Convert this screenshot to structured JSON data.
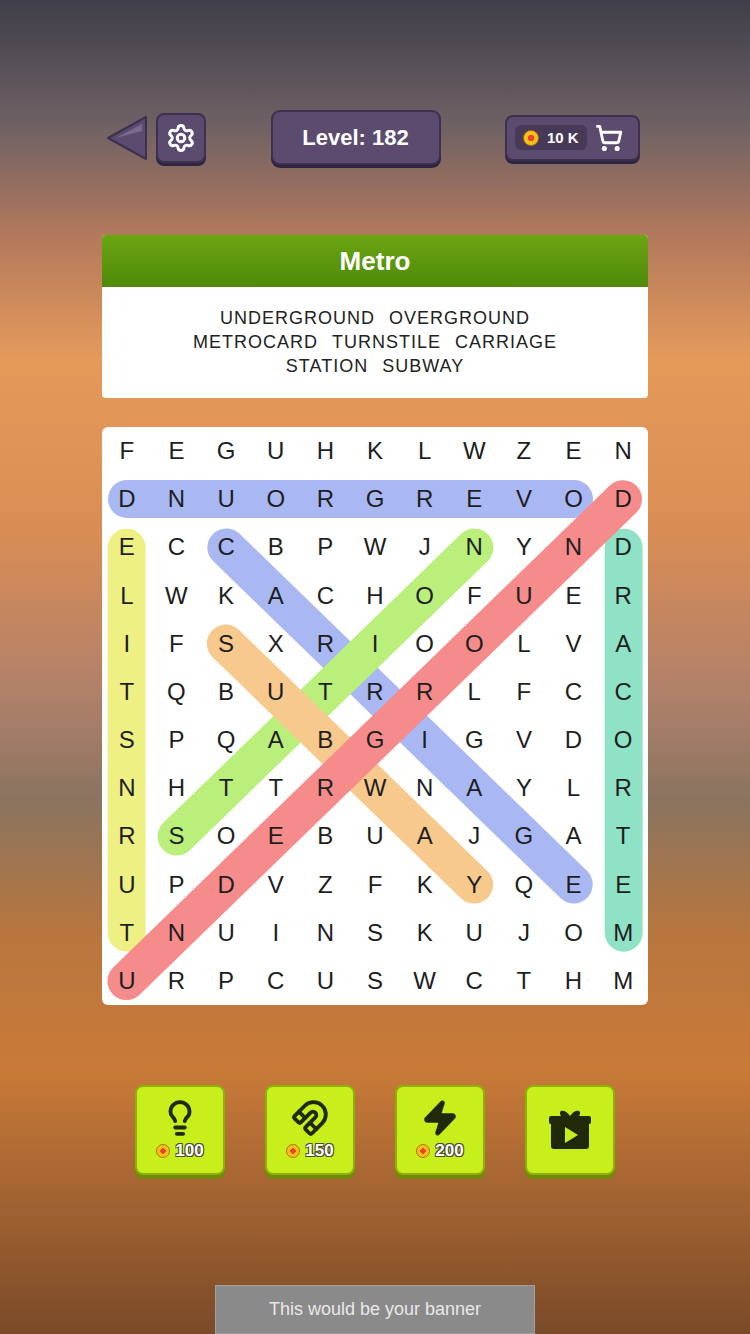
{
  "top_bar": {
    "level_label": "Level: 182",
    "coins": "10 K"
  },
  "puzzle": {
    "title": "Metro",
    "word_rows": [
      [
        "UNDERGROUND",
        "OVERGROUND"
      ],
      [
        "METROCARD",
        "TURNSTILE",
        "CARRIAGE"
      ],
      [
        "STATION",
        "SUBWAY"
      ]
    ]
  },
  "grid": {
    "rows": [
      [
        "F",
        "E",
        "G",
        "U",
        "H",
        "K",
        "L",
        "W",
        "Z",
        "E",
        "N"
      ],
      [
        "D",
        "N",
        "U",
        "O",
        "R",
        "G",
        "R",
        "E",
        "V",
        "O",
        "D"
      ],
      [
        "E",
        "C",
        "C",
        "B",
        "P",
        "W",
        "J",
        "N",
        "Y",
        "N",
        "D"
      ],
      [
        "L",
        "W",
        "K",
        "A",
        "C",
        "H",
        "O",
        "F",
        "U",
        "E",
        "R"
      ],
      [
        "I",
        "F",
        "S",
        "X",
        "R",
        "I",
        "O",
        "O",
        "L",
        "V",
        "A"
      ],
      [
        "T",
        "Q",
        "B",
        "U",
        "T",
        "R",
        "R",
        "L",
        "F",
        "C",
        "C"
      ],
      [
        "S",
        "P",
        "Q",
        "A",
        "B",
        "G",
        "I",
        "G",
        "V",
        "D",
        "O"
      ],
      [
        "N",
        "H",
        "T",
        "T",
        "R",
        "W",
        "N",
        "A",
        "Y",
        "L",
        "R"
      ],
      [
        "R",
        "S",
        "O",
        "E",
        "B",
        "U",
        "A",
        "J",
        "G",
        "A",
        "T"
      ],
      [
        "U",
        "P",
        "D",
        "V",
        "Z",
        "F",
        "K",
        "Y",
        "Q",
        "E",
        "E"
      ],
      [
        "T",
        "N",
        "U",
        "I",
        "N",
        "S",
        "K",
        "U",
        "J",
        "O",
        "M"
      ],
      [
        "U",
        "R",
        "P",
        "C",
        "U",
        "S",
        "W",
        "C",
        "T",
        "H",
        "M"
      ]
    ],
    "found_lines": [
      {
        "from": [
          1,
          0
        ],
        "to": [
          1,
          9
        ],
        "color": "#a9b7f3"
      },
      {
        "from": [
          10,
          0
        ],
        "to": [
          2,
          0
        ],
        "color": "#eef083"
      },
      {
        "from": [
          10,
          10
        ],
        "to": [
          2,
          10
        ],
        "color": "#8fe2c6"
      },
      {
        "from": [
          2,
          2
        ],
        "to": [
          9,
          9
        ],
        "color": "#a9b7f3"
      },
      {
        "from": [
          2,
          7
        ],
        "to": [
          8,
          1
        ],
        "color": "#b9ef7a"
      },
      {
        "from": [
          4,
          2
        ],
        "to": [
          9,
          7
        ],
        "color": "#f8c98c"
      },
      {
        "from": [
          1,
          10
        ],
        "to": [
          11,
          0
        ],
        "color": "#f58b8b"
      }
    ]
  },
  "boosters": [
    {
      "kind": "priced",
      "price": "100"
    },
    {
      "kind": "priced",
      "price": "150"
    },
    {
      "kind": "priced",
      "price": "200"
    },
    {
      "kind": "video"
    }
  ],
  "banner": {
    "text": "This would be your banner"
  }
}
